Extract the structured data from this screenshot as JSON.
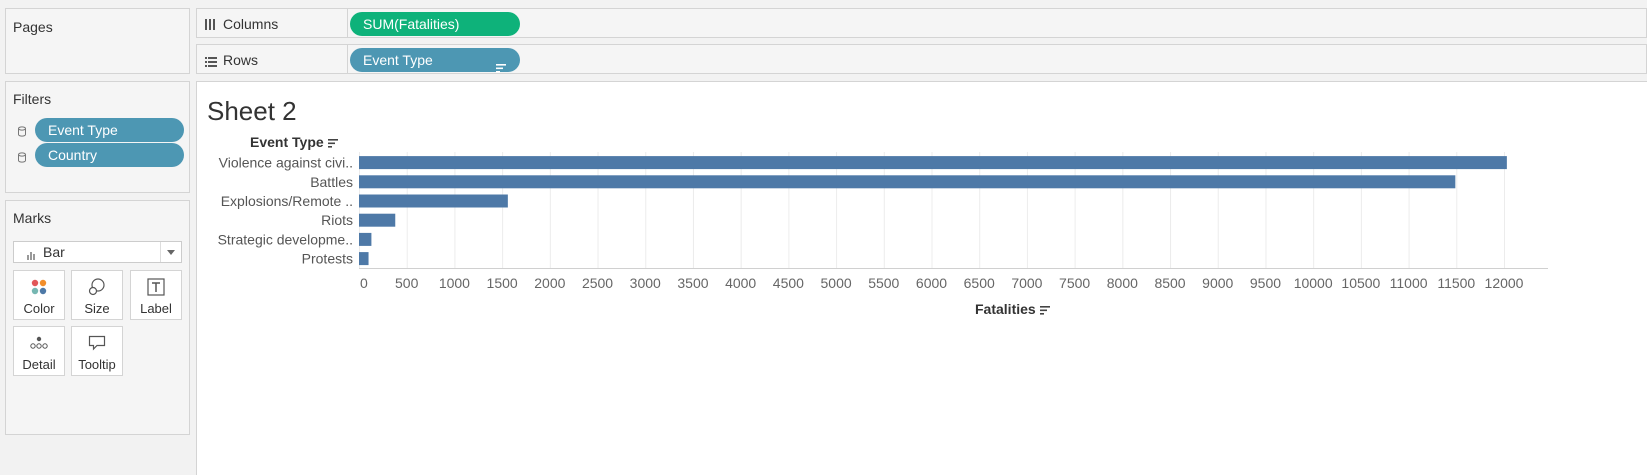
{
  "pages": {
    "title": "Pages"
  },
  "filters": {
    "title": "Filters",
    "items": [
      {
        "label": "Event Type"
      },
      {
        "label": "Country"
      }
    ]
  },
  "marks": {
    "title": "Marks",
    "type_select": "Bar",
    "buttons": [
      {
        "label": "Color"
      },
      {
        "label": "Size"
      },
      {
        "label": "Label"
      },
      {
        "label": "Detail"
      },
      {
        "label": "Tooltip"
      }
    ]
  },
  "shelves": {
    "columns": {
      "label": "Columns",
      "pill": "SUM(Fatalities)"
    },
    "rows": {
      "label": "Rows",
      "pill": "Event Type"
    }
  },
  "sheet": {
    "title": "Sheet 2",
    "row_header": "Event Type",
    "axis_title": "Fatalities"
  },
  "colors": {
    "bar": "#4e79a7",
    "dimension_pill": "#4d97b3",
    "measure_pill": "#0eb27a"
  },
  "chart_data": {
    "type": "bar",
    "orientation": "horizontal",
    "title": "Sheet 2",
    "xlabel": "Fatalities",
    "ylabel": "Event Type",
    "categories": [
      "Violence against civi..",
      "Battles",
      "Explosions/Remote ..",
      "Riots",
      "Strategic developme..",
      "Protests"
    ],
    "values": [
      12030,
      11490,
      1560,
      380,
      130,
      100
    ],
    "xlim": [
      0,
      12500
    ],
    "xticks": [
      0,
      500,
      1000,
      1500,
      2000,
      2500,
      3000,
      3500,
      4000,
      4500,
      5000,
      5500,
      6000,
      6500,
      7000,
      7500,
      8000,
      8500,
      9000,
      9500,
      10000,
      10500,
      11000,
      11500,
      12000
    ],
    "grid": true
  }
}
